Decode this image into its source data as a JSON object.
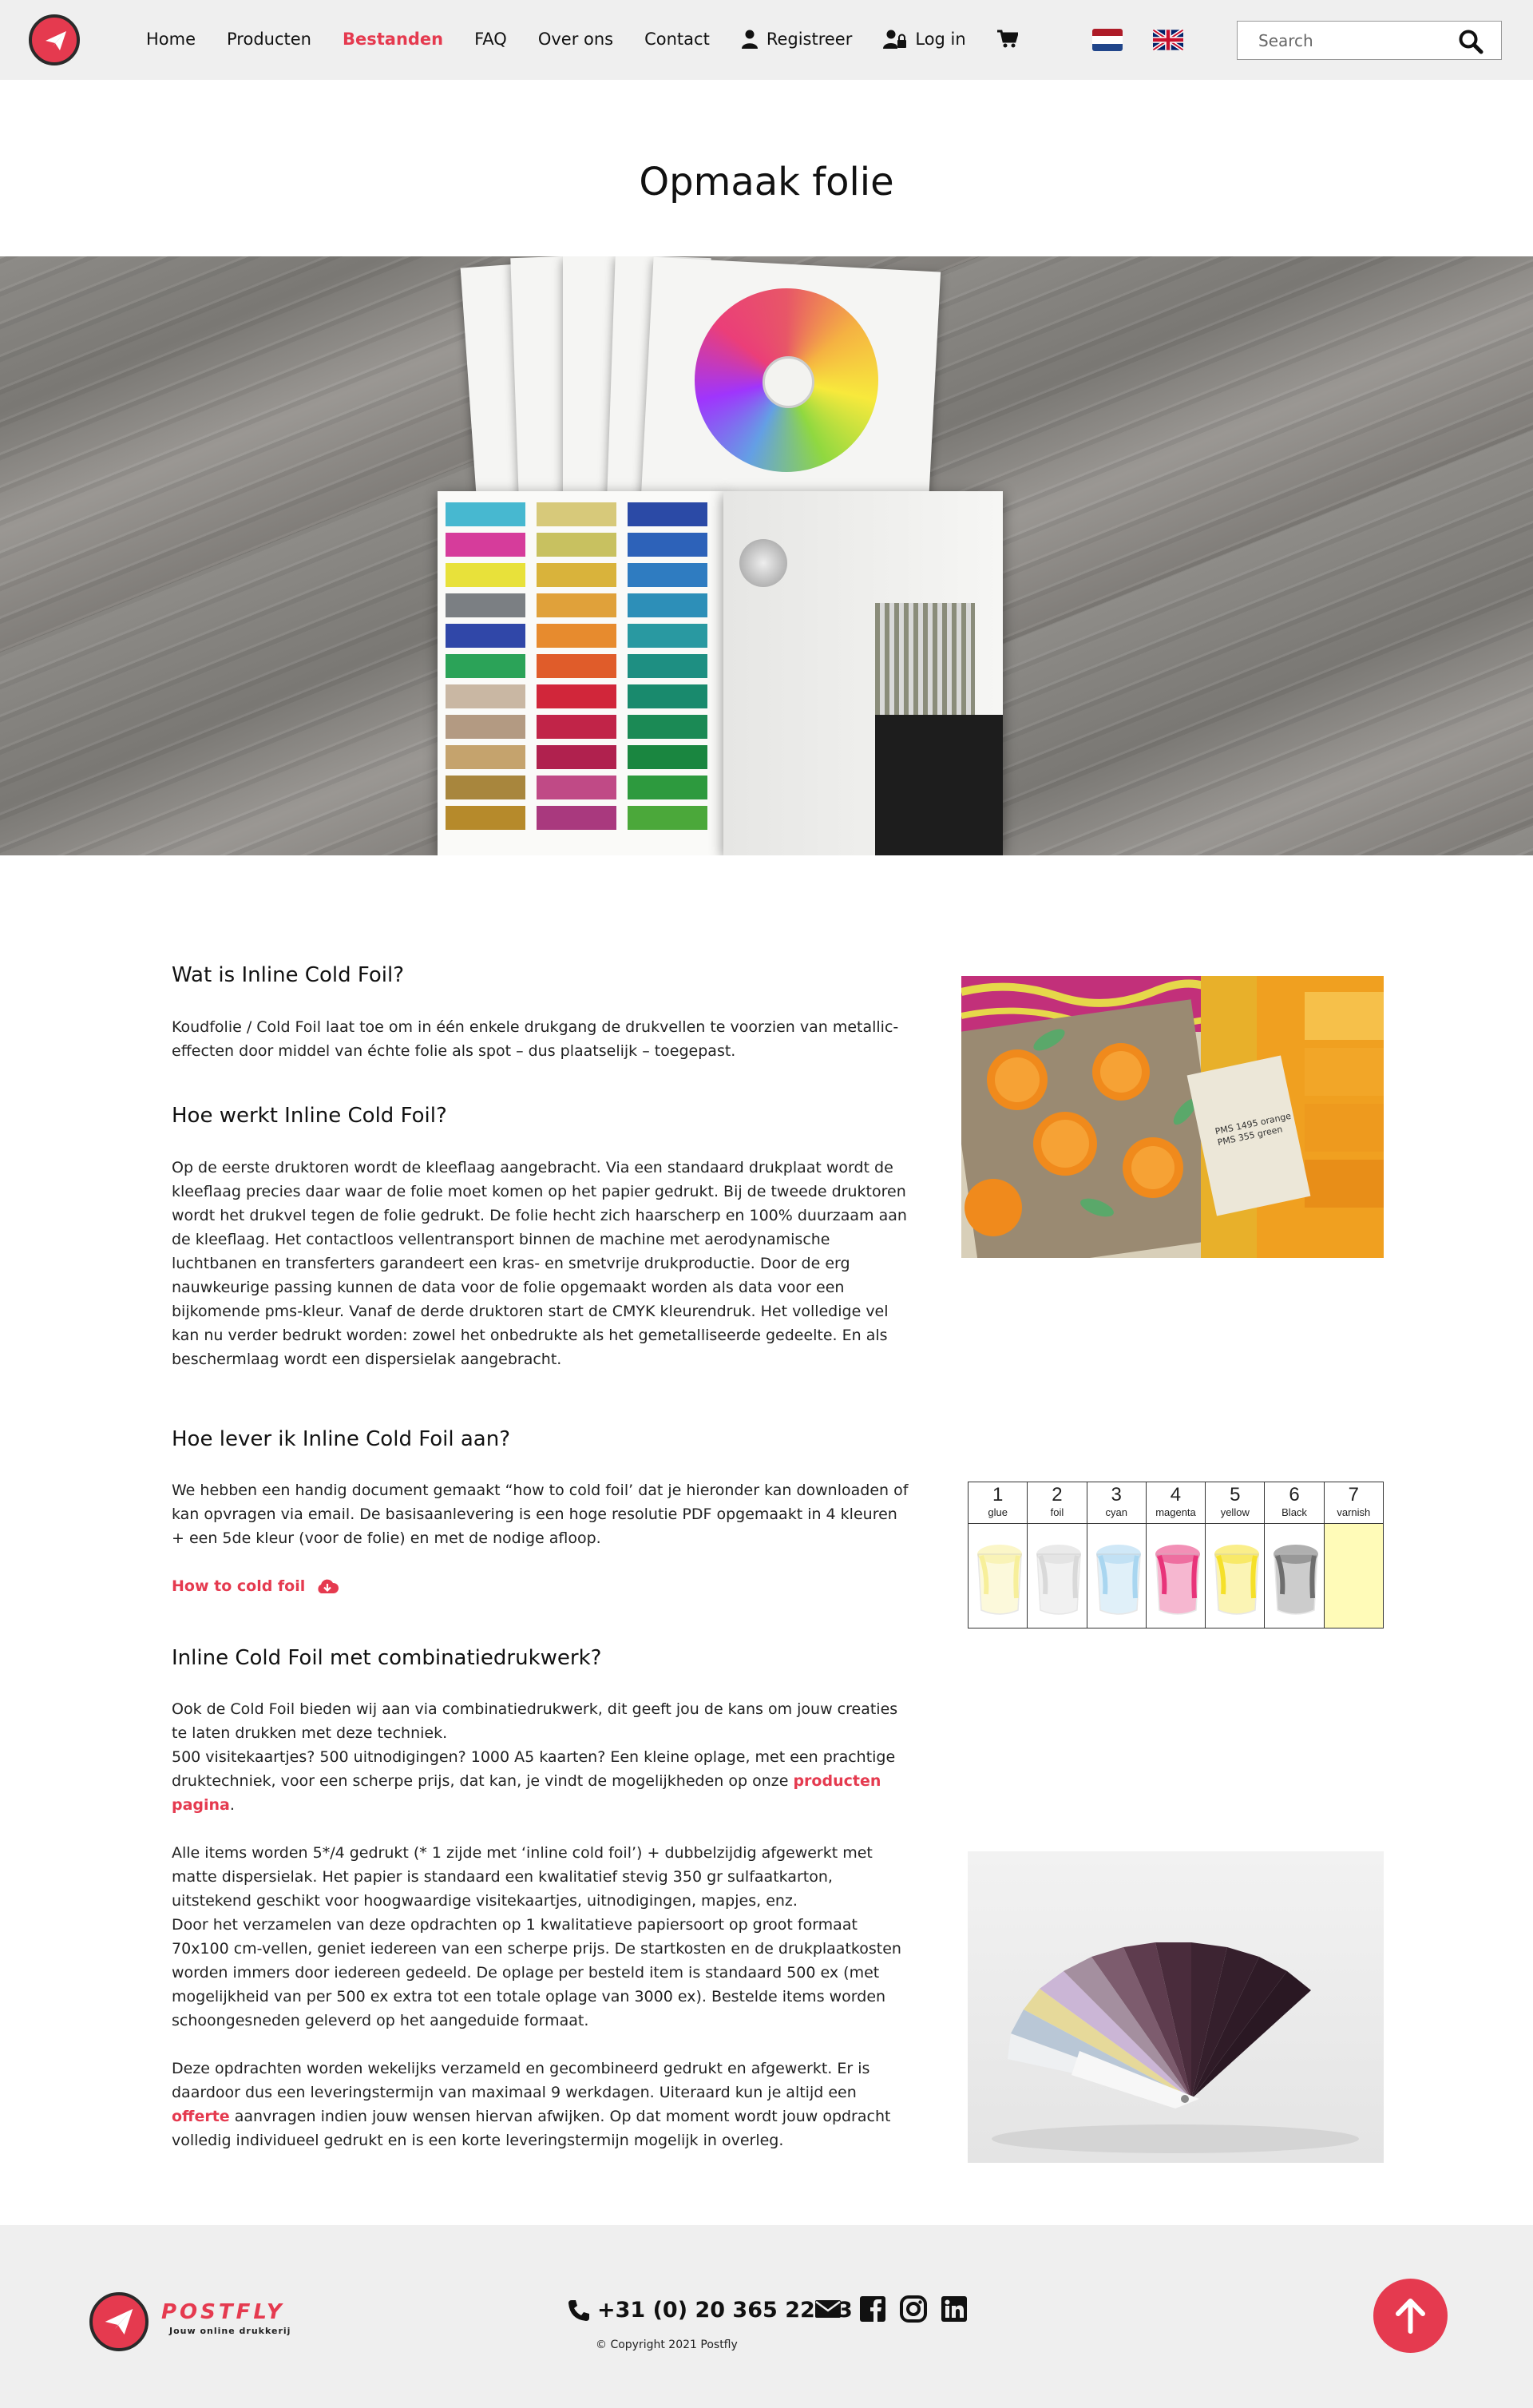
{
  "header": {
    "nav": [
      "Home",
      "Producten",
      "Bestanden",
      "FAQ",
      "Over ons",
      "Contact"
    ],
    "active_nav": "Bestanden",
    "register_label": "Registreer",
    "login_label": "Log in",
    "search_placeholder": "Search"
  },
  "page": {
    "title": "Opmaak folie"
  },
  "sections": {
    "what": {
      "heading": "Wat is Inline Cold Foil?",
      "body": "Koudfolie / Cold Foil laat toe om in één enkele drukgang de drukvellen te voorzien van metallic-effecten door middel van échte folie als spot – dus plaatselijk – toegepast."
    },
    "how": {
      "heading": "Hoe werkt Inline Cold Foil?",
      "body": "Op de eerste druktoren wordt de kleeflaag aangebracht. Via een standaard drukplaat wordt de kleeflaag precies daar waar de folie moet komen op het papier gedrukt. Bij de tweede druktoren wordt het drukvel tegen de folie gedrukt. De folie hecht zich haarscherp en 100% duurzaam aan de kleeflaag. Het contactloos vellentransport binnen de machine met aerodynamische luchtbanen en transferters garandeert een kras- en smetvrije drukproductie. Door de erg nauwkeurige passing kunnen de data voor de folie opgemaakt worden als data voor een bijkomende pms-kleur. Vanaf de derde druktoren start de CMYK kleurendruk. Het volledige vel kan nu verder bedrukt worden: zowel het onbedrukte als het gemetalliseerde gedeelte. En als beschermlaag wordt een dispersielak aangebracht."
    },
    "deliver": {
      "heading": "Hoe lever ik Inline Cold Foil aan?",
      "body": "We hebben een handig document gemaakt “how to cold foil’ dat je hieronder kan downloaden of kan opvragen via email. De basisaanlevering is een hoge resolutie PDF opgemaakt in 4 kleuren + een 5de kleur (voor de folie) en met de nodige afloop.",
      "link_label": "How to cold foil"
    },
    "combo": {
      "heading": "Inline Cold Foil met combinatiedrukwerk?",
      "p1_a": "Ook de Cold Foil bieden wij aan via combinatiedrukwerk, dit geeft jou de kans om jouw creaties te laten drukken met deze techniek.",
      "p1_b": "500 visitekaartjes? 500 uitnodigingen? 1000 A5 kaarten? Een kleine oplage, met een prachtige druktechniek, voor een scherpe prijs, dat kan, je vindt de mogelijkheden op onze ",
      "p1_link": "producten pagina",
      "p1_end": ".",
      "p2_a": "Alle items worden 5*/4 gedrukt (* 1 zijde met ‘inline cold foil’) + dubbelzijdig afgewerkt met matte dispersielak. Het papier is standaard een kwalitatief stevig 350 gr sulfaatkarton, uitstekend geschikt voor hoogwaardige visitekaartjes, uitnodigingen, mapjes, enz.",
      "p2_b": "Door het verzamelen van deze opdrachten op 1 kwalitatieve papiersoort op groot formaat 70x100 cm-vellen, geniet iedereen van een scherpe prijs. De startkosten en de drukplaatkosten worden immers door iedereen gedeeld. De oplage per besteld item is standaard 500 ex (met mogelijkheid van per 500 ex extra tot een totale oplage van 3000 ex). Bestelde items worden schoongesneden geleverd op het aangeduide formaat.",
      "p3_a": "Deze opdrachten worden wekelijks verzameld en gecombineerd gedrukt en afgewerkt. Er is daardoor dus een leveringstermijn van maximaal 9 werkdagen. Uiteraard kun je altijd een ",
      "p3_link": "offerte",
      "p3_b": " aanvragen indien jouw wensen hiervan afwijken. Op dat moment wordt jouw opdracht volledig individueel gedrukt en is een korte leveringstermijn mogelijk in overleg."
    }
  },
  "units_table": {
    "columns": [
      {
        "num": "1",
        "label": "glue",
        "color": "#f7ef9a"
      },
      {
        "num": "2",
        "label": "foil",
        "color": "#d9d9d9"
      },
      {
        "num": "3",
        "label": "cyan",
        "color": "#a9d6f0"
      },
      {
        "num": "4",
        "label": "magenta",
        "color": "#e8347a"
      },
      {
        "num": "5",
        "label": "yellow",
        "color": "#f5e02a"
      },
      {
        "num": "6",
        "label": "Black",
        "color": "#6e6e6e"
      },
      {
        "num": "7",
        "label": "varnish",
        "color": "#fffbb8"
      }
    ]
  },
  "oranges_image": {
    "labels": [
      "PMS 1495 orange",
      "PMS 355 green"
    ]
  },
  "footer": {
    "brand": "POSTFLY",
    "tagline": "Jouw online drukkerij",
    "phone": "+31 (0) 20 365 22 93",
    "copyright": "© Copyright 2021 Postfly"
  },
  "colors": {
    "accent": "#e53a4f",
    "nav_bg": "#efefef"
  }
}
